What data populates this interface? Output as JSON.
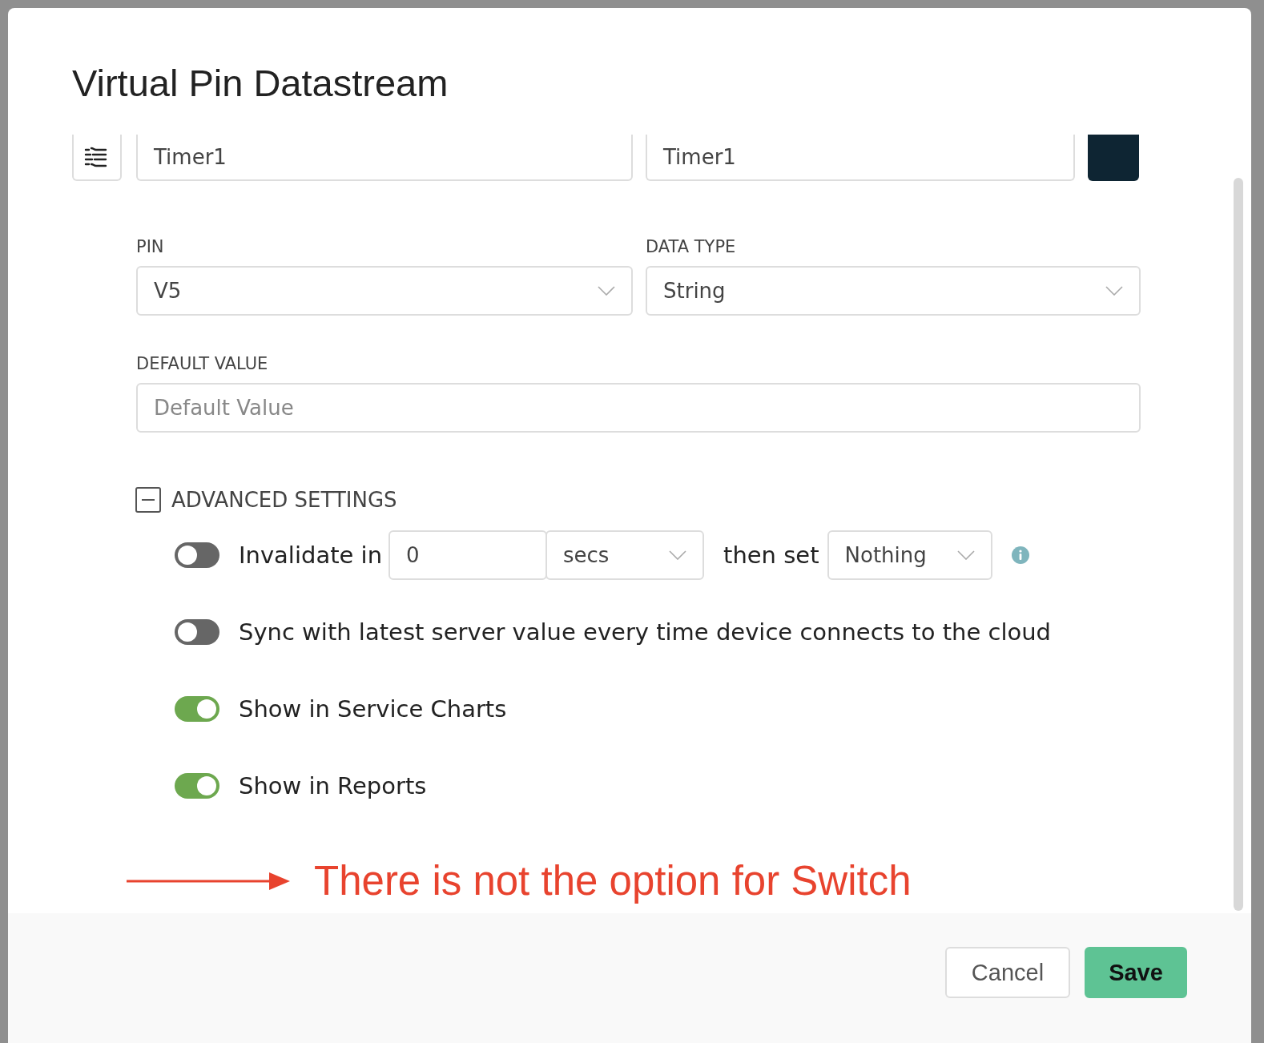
{
  "dialog": {
    "title": "Virtual Pin Datastream"
  },
  "header_row": {
    "name_value": "Timer1",
    "alias_value": "Timer1",
    "color": "#0e2533"
  },
  "pin": {
    "label": "PIN",
    "value": "V5"
  },
  "data_type": {
    "label": "DATA TYPE",
    "value": "String"
  },
  "default_value": {
    "label": "DEFAULT VALUE",
    "placeholder": "Default Value"
  },
  "advanced": {
    "label": "ADVANCED SETTINGS",
    "expanded": true
  },
  "options": [
    {
      "kind": "invalidate",
      "on": false,
      "label": "Invalidate in",
      "amount": "0",
      "unit": "secs",
      "then_label": "then set",
      "then_value": "Nothing"
    },
    {
      "kind": "toggle",
      "on": false,
      "label": "Sync with latest server value every time device connects to the cloud"
    },
    {
      "kind": "toggle",
      "on": true,
      "label": "Show in Service Charts"
    },
    {
      "kind": "toggle",
      "on": true,
      "label": "Show in Reports"
    }
  ],
  "annotation": {
    "text": "There is not the option for Switch"
  },
  "buttons": [
    {
      "label": "Cancel",
      "kind": "secondary"
    },
    {
      "label": "Save",
      "kind": "primary"
    }
  ]
}
